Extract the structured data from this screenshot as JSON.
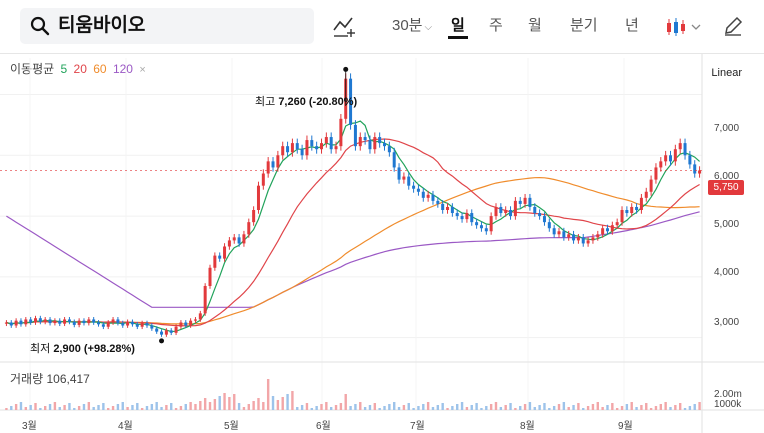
{
  "search": {
    "query": "티움바이오"
  },
  "toolbar": {
    "timeframe": "30분",
    "periods": [
      "일",
      "주",
      "월",
      "분기",
      "년"
    ],
    "active_period": "일"
  },
  "legend": {
    "title": "이동평균",
    "ma": [
      {
        "label": "5",
        "color": "#21a35b"
      },
      {
        "label": "20",
        "color": "#e0454a"
      },
      {
        "label": "60",
        "color": "#f08c2c"
      },
      {
        "label": "120",
        "color": "#9b59c5"
      }
    ],
    "close": "×"
  },
  "scale": "Linear",
  "price_axis": [
    "7,000",
    "6,000",
    "5,000",
    "4,000",
    "3,000"
  ],
  "last_price": "5,750",
  "high_label": {
    "prefix": "최고",
    "value": "7,260 (-20.80%)"
  },
  "low_label": {
    "prefix": "최저",
    "value": "2,900 (+98.28%)"
  },
  "volume": {
    "title": "거래량",
    "value": "106,417",
    "ticks": [
      "2.00m",
      "1000k"
    ]
  },
  "months": [
    "3월",
    "4월",
    "5월",
    "6월",
    "7월",
    "8월",
    "9월"
  ],
  "colors": {
    "up": "#e2393c",
    "down": "#1f78d1"
  },
  "chart_data": {
    "type": "candlestick",
    "scale": "linear",
    "ylim": [
      2600,
      7600
    ],
    "close": [
      3250,
      3200,
      3280,
      3220,
      3300,
      3250,
      3320,
      3260,
      3300,
      3240,
      3280,
      3230,
      3300,
      3260,
      3210,
      3280,
      3240,
      3300,
      3250,
      3220,
      3180,
      3250,
      3300,
      3240,
      3200,
      3260,
      3220,
      3180,
      3240,
      3200,
      3150,
      3100,
      3050,
      3120,
      3080,
      3180,
      3250,
      3200,
      3280,
      3300,
      3400,
      3850,
      4150,
      4350,
      4300,
      4500,
      4600,
      4650,
      4550,
      4700,
      4900,
      5100,
      5500,
      5700,
      5900,
      5800,
      6000,
      6150,
      6050,
      6200,
      6100,
      6000,
      6250,
      6150,
      6100,
      6200,
      6300,
      6100,
      6150,
      6600,
      7260,
      6500,
      6150,
      6300,
      6250,
      6100,
      6300,
      6200,
      6150,
      6050,
      5800,
      5600,
      5650,
      5500,
      5450,
      5400,
      5300,
      5350,
      5250,
      5200,
      5100,
      5150,
      5050,
      5000,
      4950,
      5050,
      4900,
      4850,
      4800,
      4750,
      5000,
      5150,
      5050,
      5100,
      5000,
      5250,
      5200,
      5300,
      5150,
      5050,
      5000,
      4900,
      4800,
      4700,
      4750,
      4650,
      4700,
      4600,
      4650,
      4550,
      4600,
      4650,
      4700,
      4800,
      4750,
      4850,
      4900,
      5100,
      5050,
      5150,
      5100,
      5300,
      5400,
      5600,
      5800,
      5900,
      6000,
      5900,
      6100,
      6200,
      6000,
      5850,
      5700,
      5750
    ],
    "volume_note": "daily bars, spikes around late April and May"
  }
}
